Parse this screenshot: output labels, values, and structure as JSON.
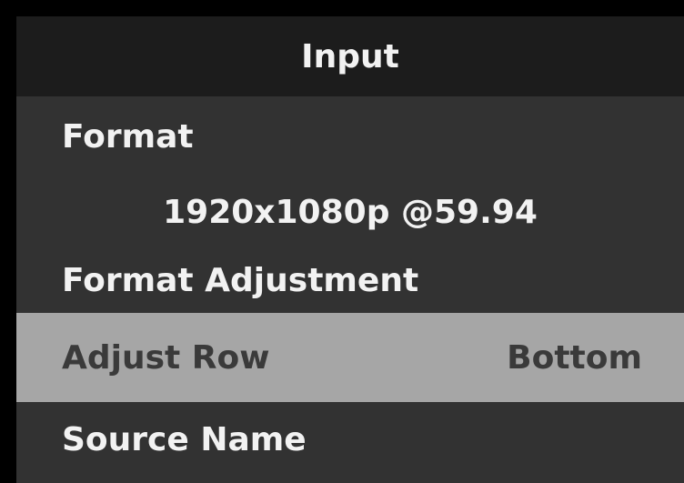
{
  "menu": {
    "title": "Input",
    "format_label": "Format",
    "format_value": "1920x1080p @59.94",
    "format_adjustment_label": "Format Adjustment",
    "adjust_row": {
      "label": "Adjust Row",
      "value": "Bottom"
    },
    "source_name_label": "Source Name"
  },
  "colors": {
    "screen_background": "#000000",
    "panel_background": "#323232",
    "header_background": "#1c1c1c",
    "text": "#f2f2f2",
    "selected_row_background": "#a6a6a6",
    "selected_row_text": "#3a3a3a"
  }
}
